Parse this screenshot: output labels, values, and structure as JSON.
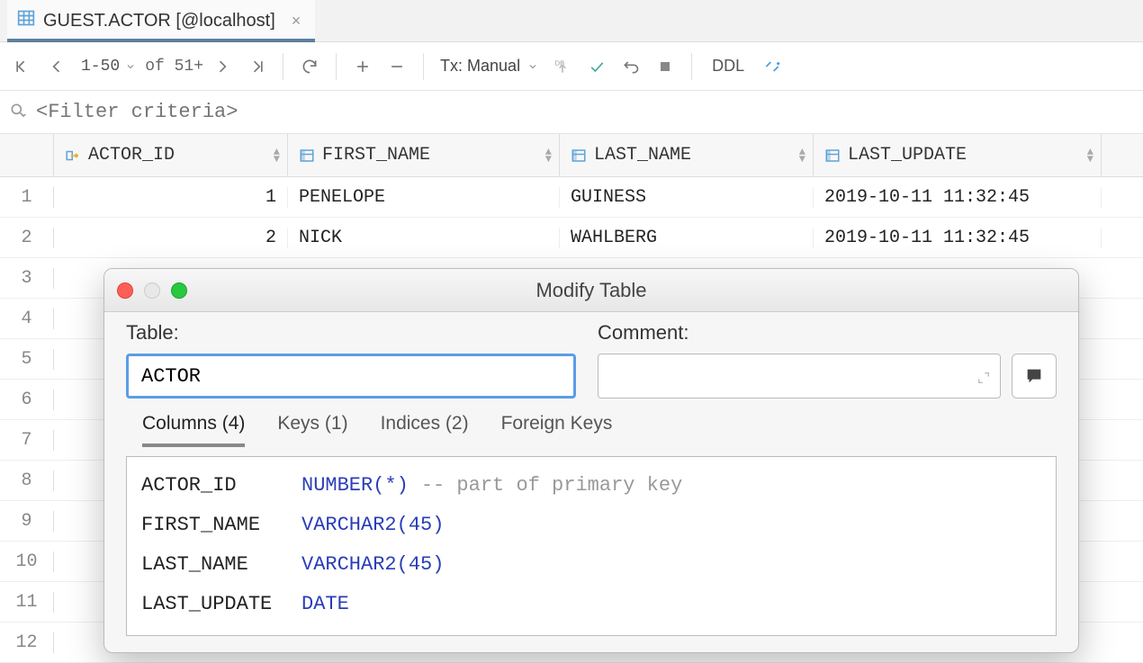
{
  "tab": {
    "title": "GUEST.ACTOR [@localhost]"
  },
  "toolbar": {
    "range": "1-50",
    "of": "of 51+",
    "tx_label": "Tx: Manual",
    "ddl": "DDL"
  },
  "filter": {
    "placeholder": "<Filter criteria>"
  },
  "grid": {
    "columns": [
      {
        "name": "ACTOR_ID"
      },
      {
        "name": "FIRST_NAME"
      },
      {
        "name": "LAST_NAME"
      },
      {
        "name": "LAST_UPDATE"
      }
    ],
    "row_numbers": [
      1,
      2,
      3,
      4,
      5,
      6,
      7,
      8,
      9,
      10,
      11,
      12
    ],
    "rows": [
      {
        "id": "1",
        "first": "PENELOPE",
        "last": "GUINESS",
        "updated": "2019-10-11 11:32:45"
      },
      {
        "id": "2",
        "first": "NICK",
        "last": "WAHLBERG",
        "updated": "2019-10-11 11:32:45"
      }
    ]
  },
  "dialog": {
    "title": "Modify Table",
    "table_label": "Table:",
    "comment_label": "Comment:",
    "table_name": "ACTOR",
    "tabs": {
      "columns": "Columns (4)",
      "keys": "Keys (1)",
      "indices": "Indices (2)",
      "fkeys": "Foreign Keys"
    },
    "columns": [
      {
        "name": "ACTOR_ID",
        "type_pre": "NUMBER(",
        "type_arg": "*",
        "type_post": ")",
        "comment": "-- part of primary key"
      },
      {
        "name": "FIRST_NAME",
        "type_pre": "VARCHAR2(",
        "type_arg": "45",
        "type_post": ")",
        "comment": ""
      },
      {
        "name": "LAST_NAME",
        "type_pre": "VARCHAR2(",
        "type_arg": "45",
        "type_post": ")",
        "comment": ""
      },
      {
        "name": "LAST_UPDATE",
        "type_pre": "DATE",
        "type_arg": "",
        "type_post": "",
        "comment": ""
      }
    ]
  }
}
